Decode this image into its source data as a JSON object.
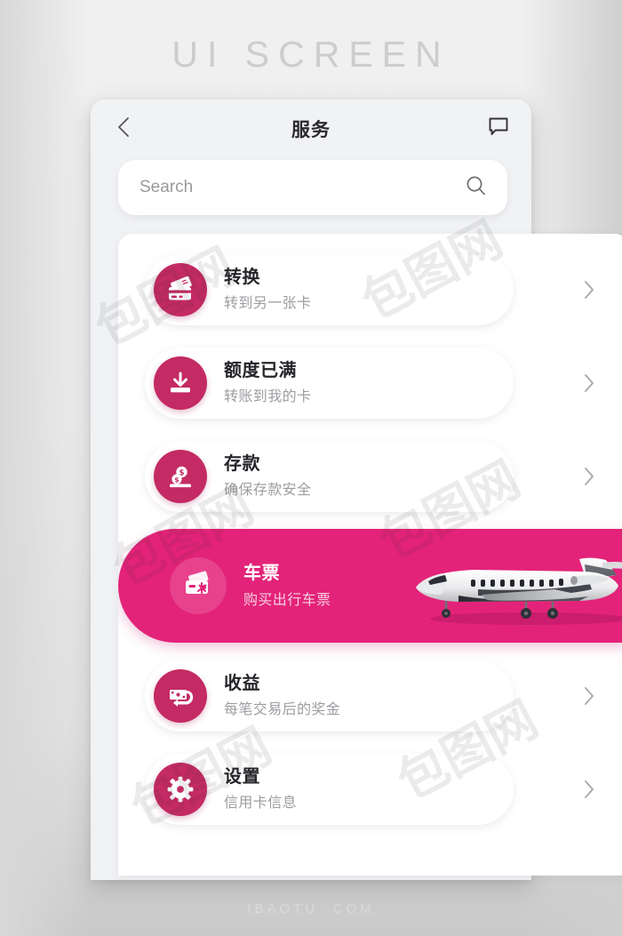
{
  "poster": {
    "top_caption": "UI SCREEN",
    "bottom_watermark": "IBAOTU. COM"
  },
  "colors": {
    "icon_pink": "#C42A63",
    "featured_pink": "#E32379",
    "title_text": "#25252A",
    "subtitle_text": "#9D9DA2",
    "phone_bg": "#F1F2F4"
  },
  "header": {
    "title": "服务",
    "back_icon": "chevron-left-icon",
    "chat_icon": "speech-bubble-icon"
  },
  "search": {
    "placeholder": "Search",
    "value": "",
    "icon": "search-icon"
  },
  "services": [
    {
      "title": "转换",
      "subtitle": "转到另一张卡",
      "icon": "credit-cards-icon",
      "chevron": "chevron-right-icon",
      "featured": false
    },
    {
      "title": "额度已满",
      "subtitle": "转账到我的卡",
      "icon": "deposit-inbox-icon",
      "chevron": "chevron-right-icon",
      "featured": false
    },
    {
      "title": "存款",
      "subtitle": "确保存款安全",
      "icon": "coins-savings-icon",
      "chevron": "chevron-right-icon",
      "featured": false
    },
    {
      "title": "车票",
      "subtitle": "购买出行车票",
      "icon": "ticket-plane-icon",
      "photo": "airplane-photo",
      "featured": true
    },
    {
      "title": "收益",
      "subtitle": "每笔交易后的奖金",
      "icon": "cashback-icon",
      "chevron": "chevron-right-icon",
      "featured": false
    },
    {
      "title": "设置",
      "subtitle": "信用卡信息",
      "icon": "gear-icon",
      "chevron": "chevron-right-icon",
      "featured": false
    }
  ],
  "watermarks": [
    "包图网",
    "包图网",
    "包图网",
    "包图网",
    "包图网",
    "包图网"
  ]
}
